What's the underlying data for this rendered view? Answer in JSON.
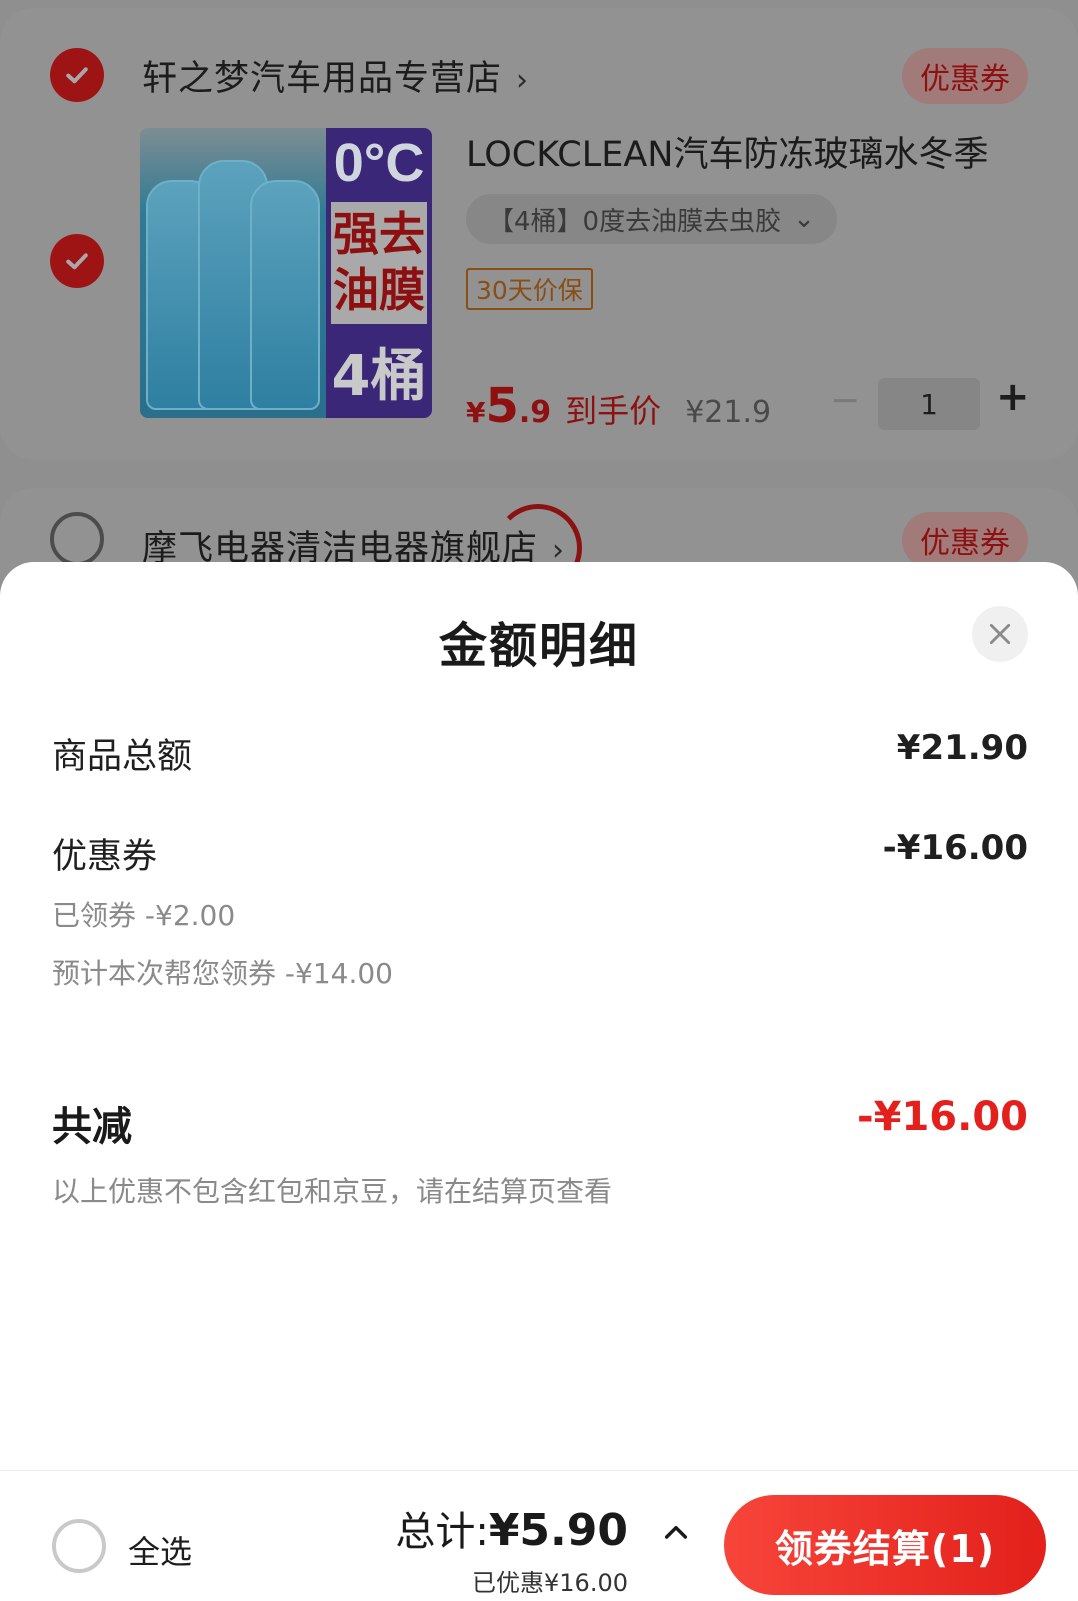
{
  "store1": {
    "name": "轩之梦汽车用品专营店",
    "chevron": "›",
    "coupon_badge": "优惠券",
    "product": {
      "image_texts": {
        "temp": "0°C",
        "line1": "强去",
        "line2": "油膜",
        "count": "4桶"
      },
      "title": "LOCKCLEAN汽车防冻玻璃水冬季",
      "variant": "【4桶】0度去油膜去虫胶",
      "variant_chevron": "⌄",
      "guarantee_tag": "30天价保",
      "price_currency": "¥",
      "price_int": "5",
      "price_dec": ".9",
      "price_label": "到手价",
      "original_price": "¥21.9",
      "qty_minus": "−",
      "quantity": "1",
      "qty_plus": "+"
    }
  },
  "store2": {
    "name": "摩飞电器清洁电器旗舰店",
    "chevron": "›",
    "coupon_badge": "优惠券"
  },
  "sheet": {
    "title": "金额明细",
    "rows": {
      "goods_total_label": "商品总额",
      "goods_total_value": "¥21.90",
      "coupon_label": "优惠券",
      "coupon_value": "-¥16.00",
      "claimed_line": "已领券 -¥2.00",
      "auto_claim_line": "预计本次帮您领券 -¥14.00",
      "total_discount_label": "共减",
      "total_discount_value": "-¥16.00",
      "note": "以上优惠不包含红包和京豆，请在结算页查看"
    }
  },
  "bottom_bar": {
    "select_all": "全选",
    "total_prefix": "总计:",
    "total_amount": "¥5.90",
    "saved": "已优惠¥16.00",
    "checkout_button": "领券结算(1)"
  },
  "colors": {
    "accent_red": "#e3201b",
    "overlay_bg": "#8f8f8f",
    "sheet_bg": "#ffffff",
    "muted_text": "#8a8a8a"
  },
  "icons": {
    "store_check": "check-icon",
    "close": "close-icon",
    "expand": "chevron-up-icon"
  }
}
